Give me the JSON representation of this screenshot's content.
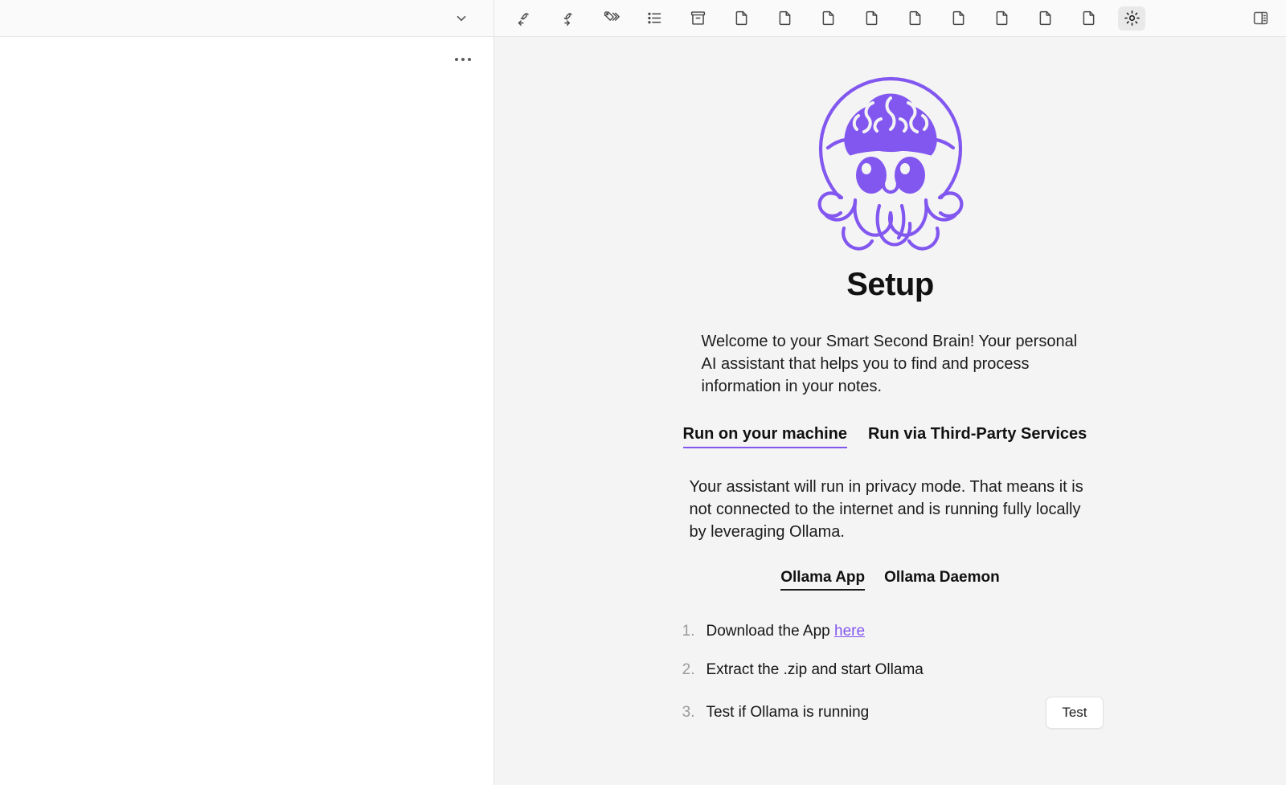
{
  "left_pane": {
    "collapse_icon": "chevron-down-icon",
    "more_icon": "ellipsis-icon"
  },
  "toolbar": {
    "icons": [
      {
        "name": "link-back-icon",
        "label": "Backlinks"
      },
      {
        "name": "link-forward-icon",
        "label": "Outgoing links"
      },
      {
        "name": "tags-icon",
        "label": "Tags"
      },
      {
        "name": "outline-list-icon",
        "label": "Outline"
      },
      {
        "name": "archive-box-icon",
        "label": "Archive"
      },
      {
        "name": "file-icon",
        "label": "File"
      },
      {
        "name": "file-icon",
        "label": "File"
      },
      {
        "name": "file-icon",
        "label": "File"
      },
      {
        "name": "file-icon",
        "label": "File"
      },
      {
        "name": "file-icon",
        "label": "File"
      },
      {
        "name": "file-icon",
        "label": "File"
      },
      {
        "name": "file-icon",
        "label": "File"
      },
      {
        "name": "file-icon",
        "label": "File"
      },
      {
        "name": "file-icon",
        "label": "File"
      },
      {
        "name": "gear-icon",
        "label": "Settings"
      }
    ],
    "right_icon": {
      "name": "sidebar-toggle-icon",
      "label": "Toggle right sidebar"
    }
  },
  "setup": {
    "logo_alt": "octopus-brain-mascot",
    "title": "Setup",
    "intro": "Welcome to your Smart Second Brain! Your personal AI assistant that helps you to find and process information in your notes.",
    "tabs": [
      {
        "label": "Run on your machine",
        "active": true
      },
      {
        "label": "Run via Third-Party Services",
        "active": false
      }
    ],
    "privacy_text": "Your assistant will run in privacy mode. That means it is not connected to the internet and is running fully locally by leveraging Ollama.",
    "subtabs": [
      {
        "label": "Ollama App",
        "active": true
      },
      {
        "label": "Ollama Daemon",
        "active": false
      }
    ],
    "steps": [
      {
        "num": "1.",
        "text_before": "Download the App ",
        "link": "here",
        "text_after": ""
      },
      {
        "num": "2.",
        "text_before": "Extract the .zip and start Ollama",
        "link": "",
        "text_after": ""
      },
      {
        "num": "3.",
        "text_before": "Test if Ollama is running",
        "link": "",
        "text_after": ""
      }
    ],
    "test_button": "Test"
  },
  "colors": {
    "accent_purple": "#8257f0",
    "panel_bg": "#f4f4f4",
    "topbar_bg": "#fafafa",
    "text": "#1c1c1c",
    "muted": "#9a9a9a"
  }
}
